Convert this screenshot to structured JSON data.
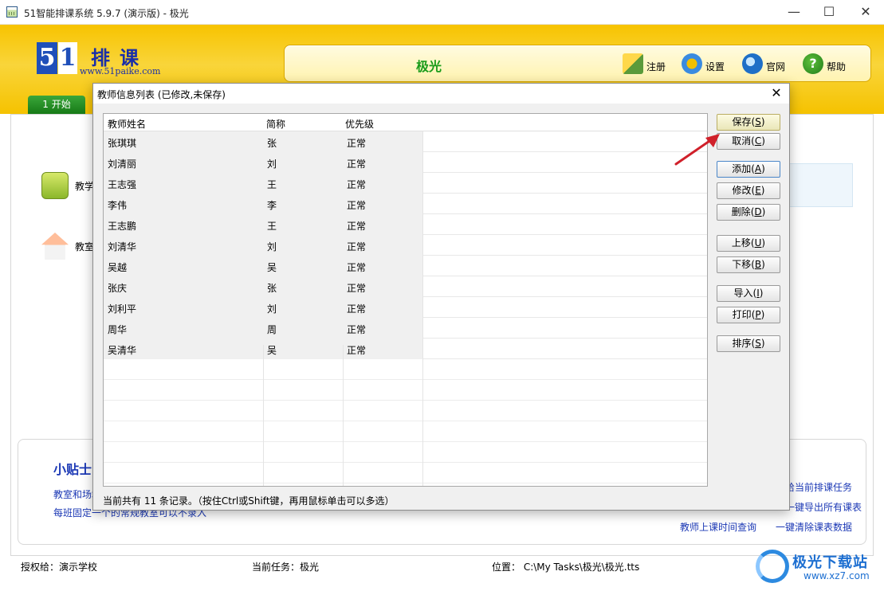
{
  "window": {
    "title": "51智能排课系统 5.9.7 (演示版) - 极光",
    "minimize": "—",
    "maximize": "☐",
    "close": "✕"
  },
  "logo": {
    "digit_5": "5",
    "digit_1": "1",
    "brand": "排课",
    "url": "www.51paike.com"
  },
  "header": {
    "task_name": "极光",
    "tools": [
      {
        "label": "注册",
        "icon": "register-icon"
      },
      {
        "label": "设置",
        "icon": "gear-icon"
      },
      {
        "label": "官网",
        "icon": "globe-icon"
      },
      {
        "label": "帮助",
        "icon": "help-icon"
      }
    ],
    "help_glyph": "?",
    "start_tab": "1 开始"
  },
  "home": {
    "items": [
      {
        "label": "教学"
      },
      {
        "label": "教室"
      }
    ]
  },
  "tips": {
    "heading": "小贴士",
    "lines": [
      "教室和场地",
      "每班固定一个的常规教室可以不录入"
    ],
    "links": [
      "给当前排课任务",
      "一键导出所有课表",
      "教师上课时间查询",
      "一键清除课表数据"
    ]
  },
  "statusbar": {
    "licensed": "授权给：演示学校",
    "current_task": "当前任务：极光",
    "location": "位置：  C:\\My Tasks\\极光\\极光.tts"
  },
  "dialog": {
    "title": "教师信息列表 (已修改,未保存)",
    "close": "✕",
    "columns": [
      "教师姓名",
      "简称",
      "优先级"
    ],
    "rows": [
      {
        "name": "张琪琪",
        "short": "张",
        "priority": "正常"
      },
      {
        "name": "刘清丽",
        "short": "刘",
        "priority": "正常"
      },
      {
        "name": "王志强",
        "short": "王",
        "priority": "正常"
      },
      {
        "name": "李伟",
        "short": "李",
        "priority": "正常"
      },
      {
        "name": "王志鹏",
        "short": "王",
        "priority": "正常"
      },
      {
        "name": "刘清华",
        "short": "刘",
        "priority": "正常"
      },
      {
        "name": "吴越",
        "short": "吴",
        "priority": "正常"
      },
      {
        "name": "张庆",
        "short": "张",
        "priority": "正常"
      },
      {
        "name": "刘利平",
        "short": "刘",
        "priority": "正常"
      },
      {
        "name": "周华",
        "short": "周",
        "priority": "正常"
      },
      {
        "name": "吴清华",
        "short": "吴",
        "priority": "正常"
      }
    ],
    "buttons": {
      "save": "保存",
      "save_key": "S",
      "cancel": "取消",
      "cancel_key": "C",
      "add": "添加",
      "add_key": "A",
      "edit": "修改",
      "edit_key": "E",
      "delete": "删除",
      "delete_key": "D",
      "move_up": "上移",
      "move_up_key": "U",
      "move_down": "下移",
      "move_down_key": "B",
      "import": "导入",
      "import_key": "I",
      "print": "打印",
      "print_key": "P",
      "sort": "排序",
      "sort_key": "S"
    },
    "status": "当前共有 11 条记录。（按住Ctrl或Shift键，再用鼠标单击可以多选）"
  },
  "watermark": {
    "text": "极光下载站",
    "url": "www.xz7.com"
  },
  "colors": {
    "header_yellow": "#f7c300",
    "link_blue": "#1b38b5",
    "task_green": "#1a9c1a",
    "arrow_red": "#d0202a"
  }
}
